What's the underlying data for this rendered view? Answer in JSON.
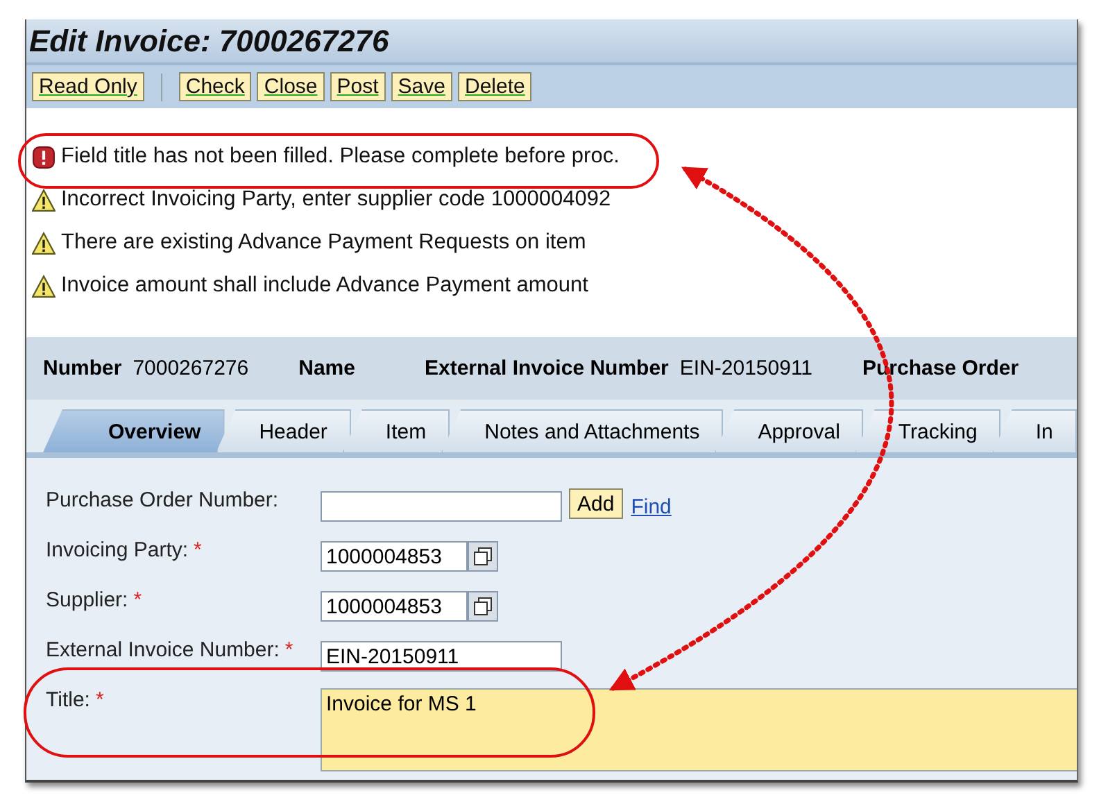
{
  "window": {
    "title": "Edit Invoice: 7000267276"
  },
  "toolbar": [
    {
      "kind": "button",
      "label": "Read Only"
    },
    {
      "kind": "separator"
    },
    {
      "kind": "button",
      "label": "Check"
    },
    {
      "kind": "button",
      "label": "Close"
    },
    {
      "kind": "button",
      "label": "Post"
    },
    {
      "kind": "button",
      "label": "Save"
    },
    {
      "kind": "button",
      "label": "Delete"
    }
  ],
  "messages": [
    {
      "kind": "error",
      "text": "Field title has not been filled. Please complete before proc."
    },
    {
      "kind": "warning",
      "text": "Incorrect Invoicing Party, enter supplier code 1000004092"
    },
    {
      "kind": "warning",
      "text": "There are existing Advance Payment Requests on item"
    },
    {
      "kind": "warning",
      "text": "Invoice amount shall include Advance Payment amount"
    }
  ],
  "header_fields": [
    {
      "label": "Number",
      "value": "7000267276"
    },
    {
      "label": "Name"
    },
    {
      "label": "External Invoice Number",
      "value": "EIN-20150911"
    },
    {
      "label": "Purchase Order"
    }
  ],
  "tabs": [
    {
      "label": "Overview",
      "selected": true
    },
    {
      "label": "Header",
      "selected": false
    },
    {
      "label": "Item",
      "selected": false
    },
    {
      "label": "Notes and Attachments",
      "selected": false
    },
    {
      "label": "Approval",
      "selected": false
    },
    {
      "label": "Tracking",
      "selected": false
    },
    {
      "label": "In",
      "selected": false
    }
  ],
  "form": [
    {
      "kind": "add",
      "label": "Purchase Order Number:",
      "button": "Add",
      "link": "Find"
    },
    {
      "kind": "lookup",
      "label": "Invoicing Party:",
      "required_mark": "*",
      "value": "1000004853"
    },
    {
      "kind": "lookup",
      "label": "Supplier:",
      "required_mark": "*",
      "value": "1000004853"
    },
    {
      "kind": "text",
      "label": "External Invoice Number:",
      "required_mark": "*",
      "value": "EIN-20150911"
    },
    {
      "kind": "textarea",
      "label": "Title:",
      "required_mark": "*",
      "value": "Invoice for MS 1"
    }
  ]
}
